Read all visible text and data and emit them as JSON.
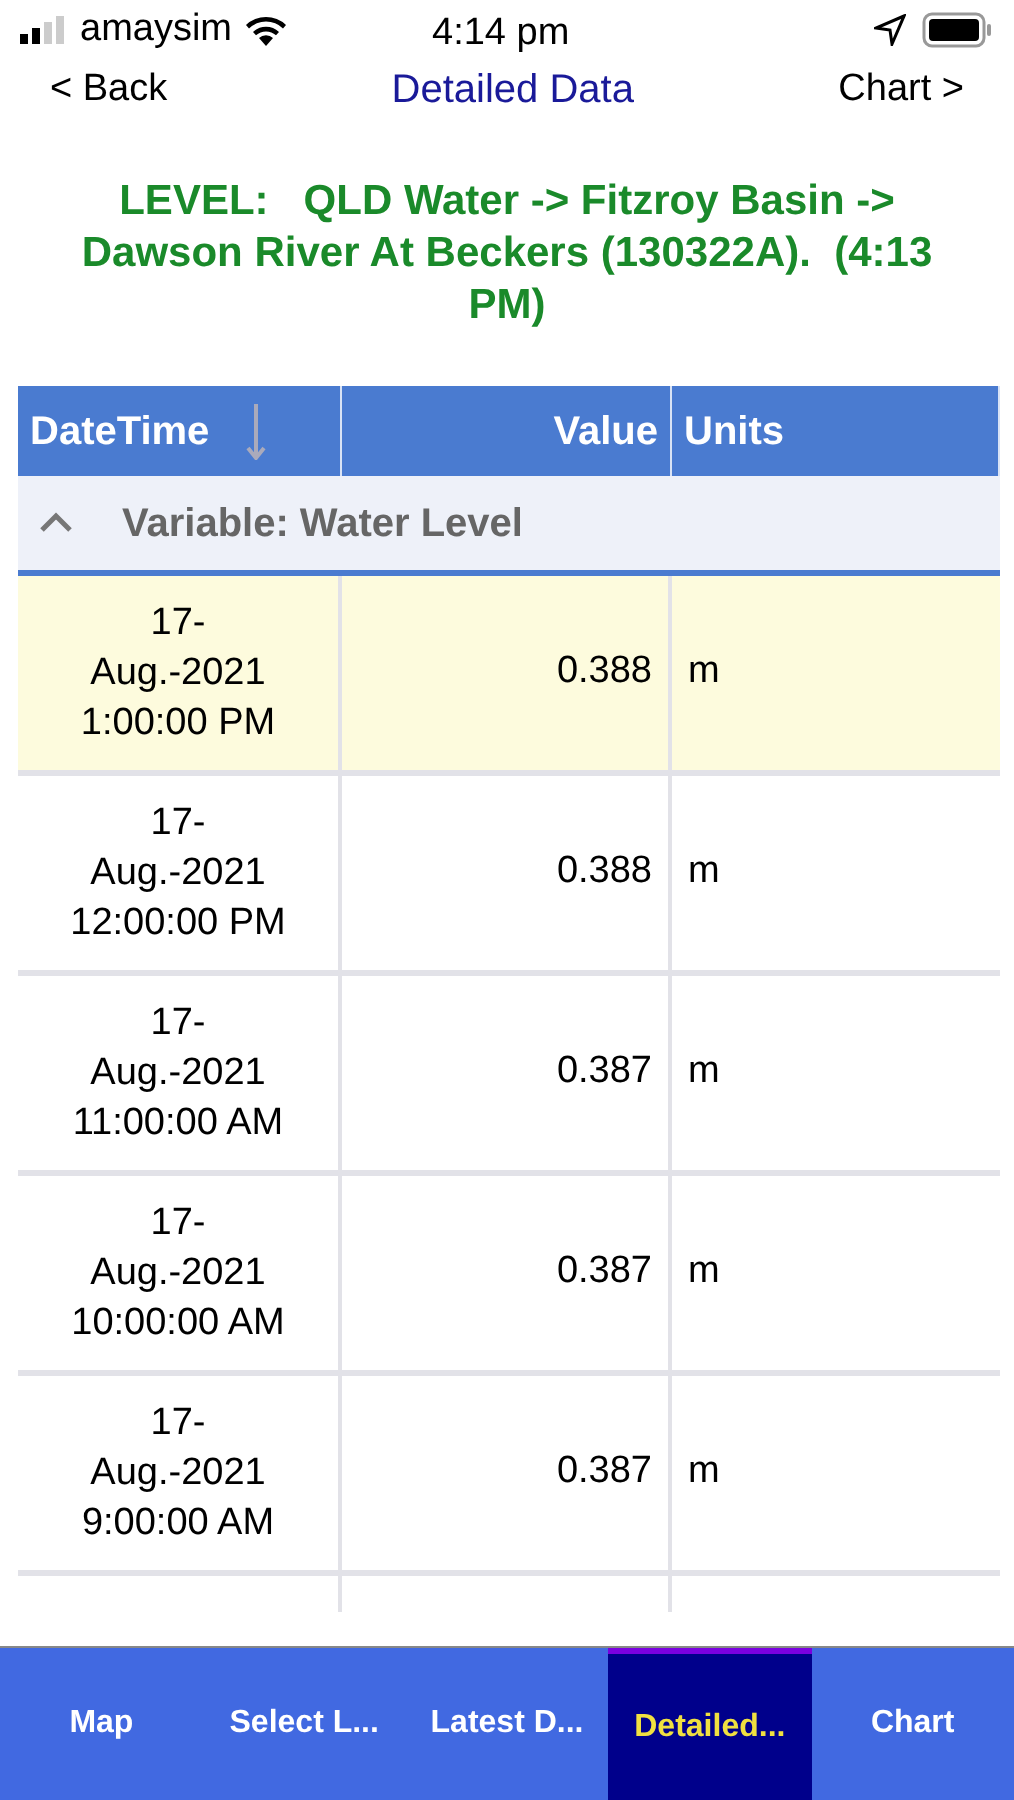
{
  "status_bar": {
    "carrier": "amaysim",
    "time": "4:14 pm"
  },
  "nav": {
    "back": "< Back",
    "title": "Detailed Data",
    "forward": "Chart >"
  },
  "heading": "LEVEL:   QLD Water -> Fitzroy Basin -> Dawson River At Beckers (130322A).  (4:13 PM)",
  "table": {
    "columns": [
      {
        "label": "DateTime",
        "sorted": true
      },
      {
        "label": "Value",
        "sorted": false
      },
      {
        "label": "Units",
        "sorted": false
      }
    ],
    "group": {
      "label": "Variable: Water Level",
      "expanded": true
    },
    "rows": [
      {
        "datetime": [
          "17-",
          "Aug.-2021",
          "1:00:00 PM"
        ],
        "value": "0.388",
        "units": "m",
        "selected": true
      },
      {
        "datetime": [
          "17-",
          "Aug.-2021",
          "12:00:00 PM"
        ],
        "value": "0.388",
        "units": "m",
        "selected": false
      },
      {
        "datetime": [
          "17-",
          "Aug.-2021",
          "11:00:00 AM"
        ],
        "value": "0.387",
        "units": "m",
        "selected": false
      },
      {
        "datetime": [
          "17-",
          "Aug.-2021",
          "10:00:00 AM"
        ],
        "value": "0.387",
        "units": "m",
        "selected": false
      },
      {
        "datetime": [
          "17-",
          "Aug.-2021",
          "9:00:00 AM"
        ],
        "value": "0.387",
        "units": "m",
        "selected": false
      }
    ]
  },
  "tabs": [
    {
      "label": "Map",
      "selected": false
    },
    {
      "label": "Select L...",
      "selected": false
    },
    {
      "label": "Latest D...",
      "selected": false
    },
    {
      "label": "Detailed...",
      "selected": true
    },
    {
      "label": "Chart",
      "selected": false
    }
  ]
}
